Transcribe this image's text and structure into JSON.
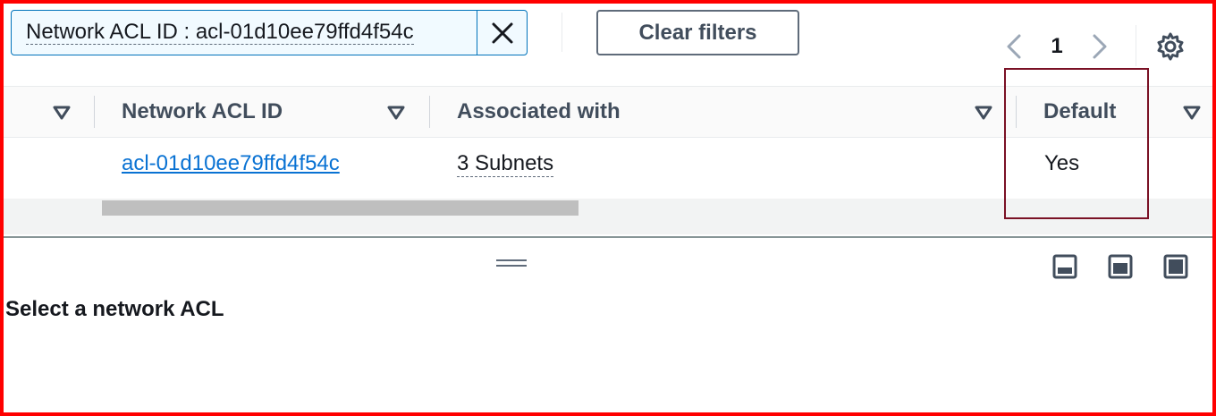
{
  "filter": {
    "token_text": "Network ACL ID : acl-01d10ee79ffd4f54c",
    "remove_icon": "close-icon"
  },
  "toolbar": {
    "clear_filters_label": "Clear filters"
  },
  "pagination": {
    "current_page": "1",
    "prev_icon": "chevron-left-icon",
    "next_icon": "chevron-right-icon"
  },
  "settings_icon": "gear-icon",
  "table": {
    "columns": [
      {
        "label": ""
      },
      {
        "label": "Network ACL ID"
      },
      {
        "label": "Associated with"
      },
      {
        "label": "Default"
      }
    ],
    "rows": [
      {
        "network_acl_id": "acl-01d10ee79ffd4f54c",
        "associated_with": "3 Subnets",
        "default": "Yes"
      }
    ]
  },
  "split_panel": {
    "position_icons": [
      "panel-bottom-icon",
      "panel-side-icon",
      "panel-full-icon"
    ],
    "title": "Select a network ACL"
  },
  "colors": {
    "link": "#0972d3",
    "token_border": "#0073bb",
    "annotation_frame": "#ff0000",
    "highlight_box": "#7a1125"
  }
}
